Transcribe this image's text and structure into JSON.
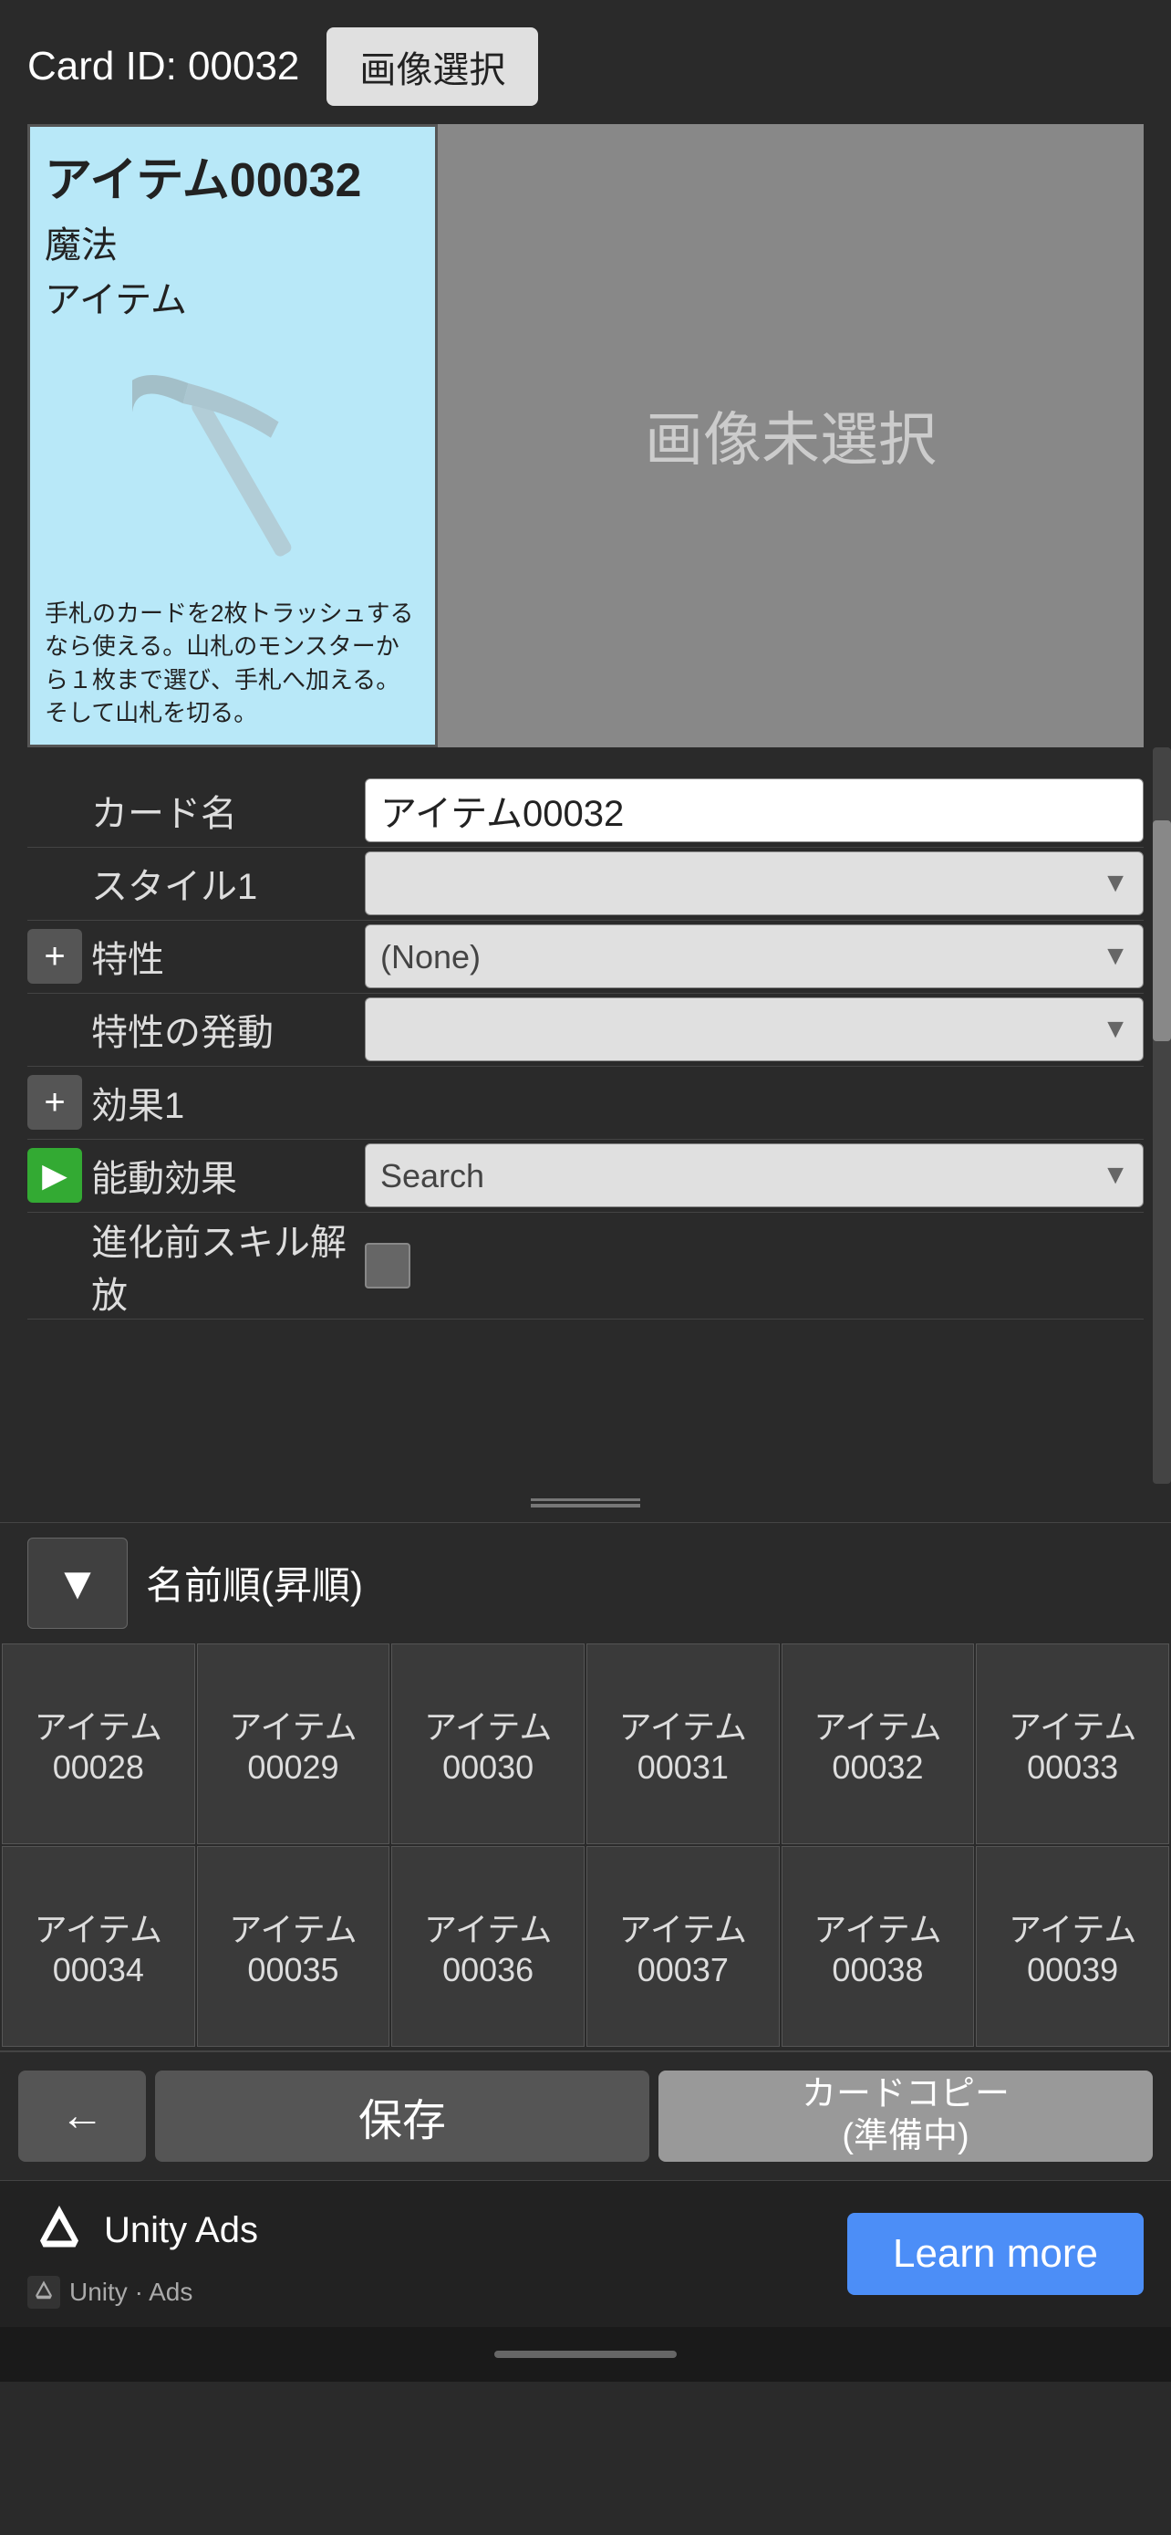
{
  "header": {
    "card_id_label": "Card ID: 00032",
    "image_select_btn": "画像選択"
  },
  "card_preview": {
    "title": "アイテム00032",
    "type1": "魔法",
    "type2": "アイテム",
    "description": "手札のカードを2枚トラッシュするなら使える。山札のモンスターから１枚まで選び、手札へ加える。そして山札を切る。"
  },
  "no_image": "画像未選択",
  "form": {
    "card_name_label": "カード名",
    "card_name_value": "アイテム00032",
    "style1_label": "スタイル1",
    "style1_placeholder": "",
    "trait_label": "特性",
    "trait_value": "(None)",
    "trait_trigger_label": "特性の発動",
    "effect1_label": "効果1",
    "active_effect_label": "能動効果",
    "active_effect_placeholder": "Search",
    "pre_evolve_label": "進化前スキル解放"
  },
  "sort": {
    "sort_label": "名前順(昇順)",
    "sort_icon": "▼"
  },
  "grid_cards": [
    {
      "id": "アイテム\n00028"
    },
    {
      "id": "アイテム\n00029"
    },
    {
      "id": "アイテム\n00030"
    },
    {
      "id": "アイテム\n00031"
    },
    {
      "id": "アイテム\n00032"
    },
    {
      "id": "アイテム\n00033"
    },
    {
      "id": "アイテム\n00034"
    },
    {
      "id": "アイテム\n00035"
    },
    {
      "id": "アイテム\n00036"
    },
    {
      "id": "アイテム\n00037"
    },
    {
      "id": "アイテム\n00038"
    },
    {
      "id": "アイテム\n00039"
    }
  ],
  "toolbar": {
    "back_icon": "←",
    "save_label": "保存",
    "copy_label": "カードコピー\n(準備中)"
  },
  "ad": {
    "brand": "Unity Ads",
    "small_text": "Unity · Ads",
    "learn_more": "Learn more"
  }
}
